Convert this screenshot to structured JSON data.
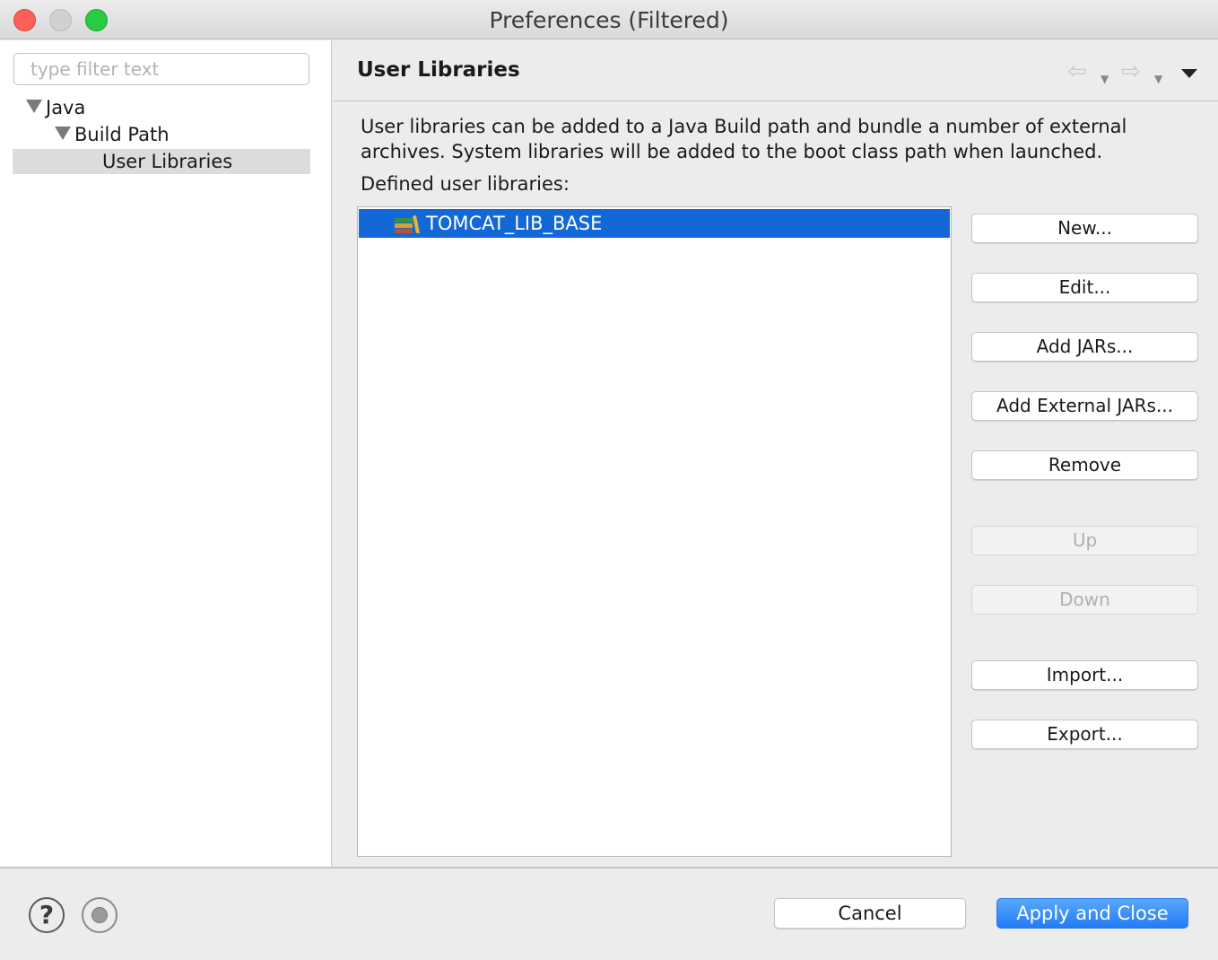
{
  "window": {
    "title": "Preferences (Filtered)"
  },
  "sidebar": {
    "filter_placeholder": "type filter text",
    "filter_value": "",
    "tree": [
      {
        "label": "Java",
        "expanded": true
      },
      {
        "label": "Build Path",
        "expanded": true
      },
      {
        "label": "User Libraries",
        "selected": true
      }
    ]
  },
  "page": {
    "title": "User Libraries",
    "description_line1": "User libraries can be added to a Java Build path and bundle a number of external",
    "description_line2": "archives. System libraries will be added to the boot class path when launched.",
    "list_label": "Defined user libraries:",
    "libraries": [
      {
        "name": "TOMCAT_LIB_BASE",
        "icon": "library-icon",
        "selected": true
      }
    ]
  },
  "buttons": {
    "new": "New...",
    "edit": "Edit...",
    "add_jars": "Add JARs...",
    "add_external_jars": "Add External JARs...",
    "remove": "Remove",
    "up": "Up",
    "down": "Down",
    "import": "Import...",
    "export": "Export..."
  },
  "footer": {
    "help_glyph": "?",
    "cancel": "Cancel",
    "apply_and_close": "Apply and Close"
  },
  "colors": {
    "selection": "#1268d6",
    "primary_button": "#237cf6",
    "close_light": "#fc5f57",
    "zoom_light": "#2acb42"
  }
}
